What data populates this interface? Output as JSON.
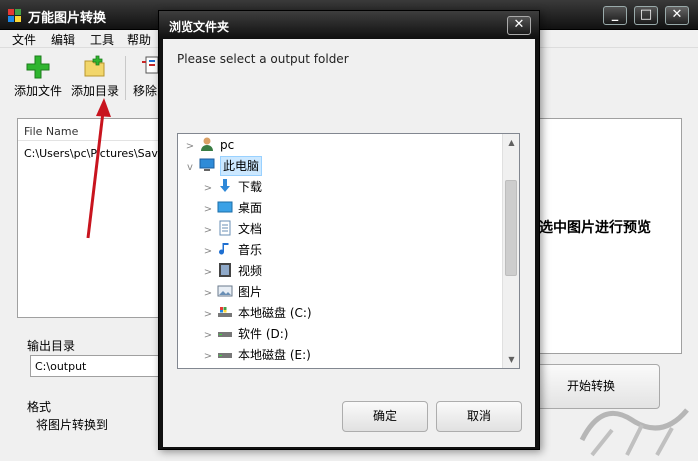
{
  "app": {
    "title": "万能图片转换",
    "controls": {
      "minimize": "_",
      "maximize": "□",
      "close": "✕"
    }
  },
  "menu": [
    "文件",
    "编辑",
    "工具",
    "帮助"
  ],
  "toolbar": {
    "add_file": "添加文件",
    "add_folder": "添加目录",
    "remove": "移除"
  },
  "file_list": {
    "header": "File Name",
    "rows": [
      "C:\\Users\\pc\\Pictures\\Saved"
    ]
  },
  "preview": {
    "hint": "选中图片进行预览"
  },
  "output": {
    "label": "输出目录",
    "value": "C:\\output"
  },
  "format": {
    "label": "格式",
    "convert_to": "将图片转换到"
  },
  "start_button": "开始转换",
  "dialog": {
    "title": "浏览文件夹",
    "close": "✕",
    "prompt": "Please select a output folder",
    "tree": [
      {
        "label": "pc",
        "icon": "user-icon",
        "chevron": ">",
        "selected": false
      },
      {
        "label": "此电脑",
        "icon": "computer-icon",
        "chevron": "v",
        "selected": true
      },
      {
        "label": "下载",
        "icon": "download-icon",
        "chevron": ">",
        "selected": false
      },
      {
        "label": "桌面",
        "icon": "desktop-icon",
        "chevron": ">",
        "selected": false
      },
      {
        "label": "文档",
        "icon": "document-icon",
        "chevron": ">",
        "selected": false
      },
      {
        "label": "音乐",
        "icon": "music-icon",
        "chevron": ">",
        "selected": false
      },
      {
        "label": "视频",
        "icon": "video-icon",
        "chevron": ">",
        "selected": false
      },
      {
        "label": "图片",
        "icon": "picture-icon",
        "chevron": ">",
        "selected": false
      },
      {
        "label": "本地磁盘 (C:)",
        "icon": "system-drive-icon",
        "chevron": ">",
        "selected": false
      },
      {
        "label": "软件 (D:)",
        "icon": "drive-icon",
        "chevron": ">",
        "selected": false
      },
      {
        "label": "本地磁盘 (E:)",
        "icon": "drive-icon",
        "chevron": ">",
        "selected": false
      }
    ],
    "ok": "确定",
    "cancel": "取消"
  },
  "colors": {
    "titlebar": "#1a1a1a",
    "tree_selection": "#cce8ff",
    "annotation_arrow": "#c8141e",
    "add_icon_green": "#2fb52f"
  }
}
